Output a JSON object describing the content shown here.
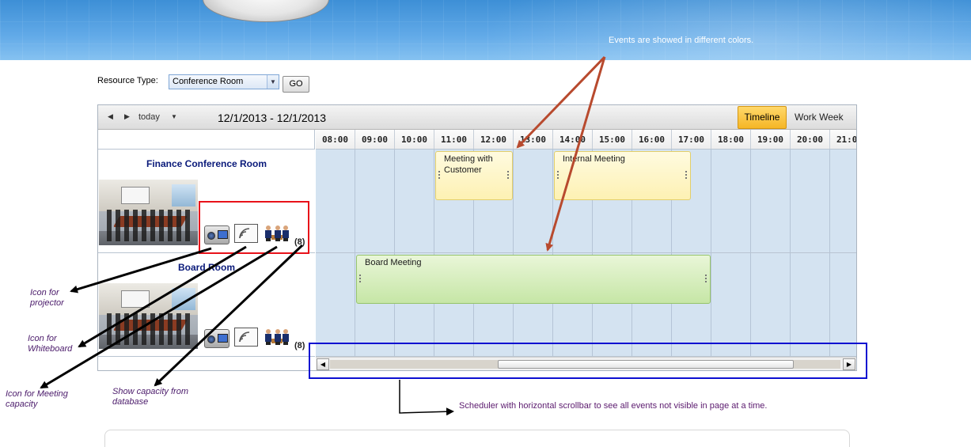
{
  "resource_filter": {
    "label": "Resource Type:",
    "selected": "Conference Room",
    "go_label": "GO"
  },
  "toolbar": {
    "today_label": "today",
    "date_range": "12/1/2013 - 12/1/2013",
    "views": {
      "timeline": "Timeline",
      "work_week": "Work Week"
    },
    "active_view": "Timeline"
  },
  "time_slots": [
    "08:00",
    "09:00",
    "10:00",
    "11:00",
    "12:00",
    "13:00",
    "14:00",
    "15:00",
    "16:00",
    "17:00",
    "18:00",
    "19:00",
    "20:00",
    "21:00"
  ],
  "resources": [
    {
      "name": "Finance Conference Room",
      "capacity": "(8)"
    },
    {
      "name": "Board Room",
      "capacity": "(8)"
    }
  ],
  "events": [
    {
      "title": "Meeting with Customer",
      "resource": "Finance Conference Room",
      "start": "11:00",
      "end": "13:00",
      "color": "#fdf1b3"
    },
    {
      "title": "Internal Meeting",
      "resource": "Finance Conference Room",
      "start": "14:00",
      "end": "17:30",
      "color": "#fdf1b3"
    },
    {
      "title": "Board Meeting",
      "resource": "Board Room",
      "start": "09:00",
      "end": "18:00",
      "color": "#c6e6a6"
    }
  ],
  "annotations": {
    "colors_note": "Events are showed in different colors.",
    "projector": "Icon for projector",
    "whiteboard": "Icon for Whiteboard",
    "meeting_capacity": "Icon for Meeting capacity",
    "capacity_db": "Show capacity from database",
    "scrollbar_note": "Scheduler with horizontal scrollbar to see all events not visible in page at a time."
  },
  "colors": {
    "banner": "#62aae8",
    "timeline_active": "#f5b626",
    "grid_bg": "#d4e3f1",
    "highlight_red": "#e8121a",
    "highlight_blue": "#0b0fd1",
    "arrow_red": "#b84a2e",
    "arrow_black": "#000000"
  },
  "icons": [
    "projector-icon",
    "whiteboard-icon",
    "capacity-icon",
    "prev-icon",
    "next-icon",
    "dropdown-icon"
  ]
}
